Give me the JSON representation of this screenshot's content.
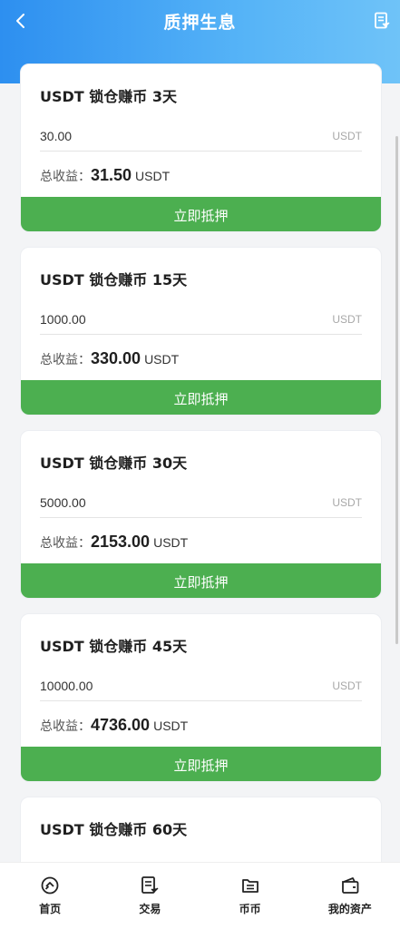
{
  "header": {
    "title": "质押生息"
  },
  "plans": [
    {
      "title": "USDT 锁仓赚币 3天",
      "amount": "30.00",
      "unit": "USDT",
      "income_label": "总收益：",
      "income_value": "31.50",
      "income_unit": "USDT",
      "button_label": "立即抵押"
    },
    {
      "title": "USDT 锁仓赚币 15天",
      "amount": "1000.00",
      "unit": "USDT",
      "income_label": "总收益：",
      "income_value": "330.00",
      "income_unit": "USDT",
      "button_label": "立即抵押"
    },
    {
      "title": "USDT 锁仓赚币 30天",
      "amount": "5000.00",
      "unit": "USDT",
      "income_label": "总收益：",
      "income_value": "2153.00",
      "income_unit": "USDT",
      "button_label": "立即抵押"
    },
    {
      "title": "USDT 锁仓赚币 45天",
      "amount": "10000.00",
      "unit": "USDT",
      "income_label": "总收益：",
      "income_value": "4736.00",
      "income_unit": "USDT",
      "button_label": "立即抵押"
    },
    {
      "title": "USDT 锁仓赚币 60天"
    }
  ],
  "bottom_nav": [
    {
      "label": "首页",
      "icon": "home-icon"
    },
    {
      "label": "交易",
      "icon": "trade-icon"
    },
    {
      "label": "币币",
      "icon": "exchange-icon"
    },
    {
      "label": "我的资产",
      "icon": "wallet-icon"
    }
  ],
  "colors": {
    "header_start": "#2d8ff0",
    "header_end": "#6fc3f8",
    "button": "#4caf50"
  }
}
